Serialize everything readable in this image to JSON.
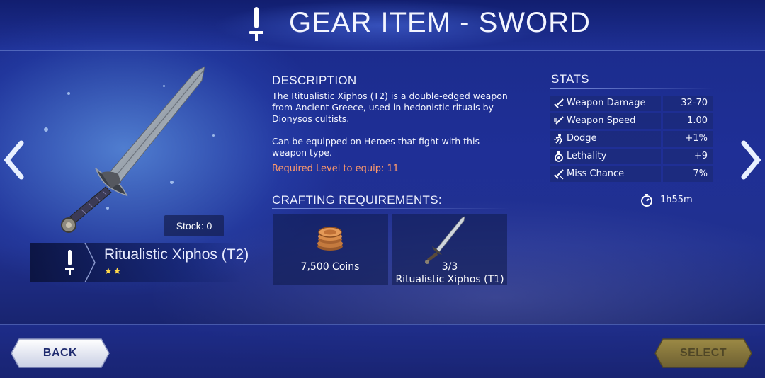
{
  "header": {
    "title": "GEAR ITEM - SWORD",
    "title_icon": "sword-icon"
  },
  "navigation": {
    "prev_icon": "chevron-left-icon",
    "next_icon": "chevron-right-icon"
  },
  "item": {
    "stock_label": "Stock: 0",
    "name": "Ritualistic Xiphos (T2)",
    "stars": "★★",
    "star_count": 2,
    "type_icon": "sword-icon"
  },
  "description": {
    "heading": "DESCRIPTION",
    "paragraph_1": "The Ritualistic Xiphos (T2) is a double-edged weapon from Ancient Greece, used in hedonistic rituals by Dionysos cultists.",
    "paragraph_2": "Can be equipped on Heroes that fight with this weapon type.",
    "required_level": "Required Level to equip: 11"
  },
  "crafting": {
    "heading": "CRAFTING REQUIREMENTS:",
    "items": [
      {
        "label": "7,500 Coins",
        "icon": "coin-stack-icon"
      },
      {
        "count": "3/3",
        "label": "Ritualistic Xiphos (T1)",
        "icon": "sword-icon"
      }
    ]
  },
  "stats": {
    "heading": "STATS",
    "rows": [
      {
        "name": "Weapon Damage",
        "value": "32-70",
        "icon": "sword-damage-icon"
      },
      {
        "name": "Weapon Speed",
        "value": "1.00",
        "icon": "sword-speed-icon"
      },
      {
        "name": "Dodge",
        "value": "+1%",
        "icon": "dodge-icon"
      },
      {
        "name": "Lethality",
        "value": "+9",
        "icon": "potion-icon"
      },
      {
        "name": "Miss Chance",
        "value": "7%",
        "icon": "miss-icon"
      }
    ],
    "craft_time": "1h55m",
    "craft_time_icon": "stopwatch-icon"
  },
  "buttons": {
    "back": "BACK",
    "select": "SELECT"
  },
  "colors": {
    "background": "#1f2f96",
    "required_level": "#ff9a6b",
    "stars": "#ffd84a",
    "select_button": "#8b7a3a",
    "back_button": "#dde2f2"
  }
}
